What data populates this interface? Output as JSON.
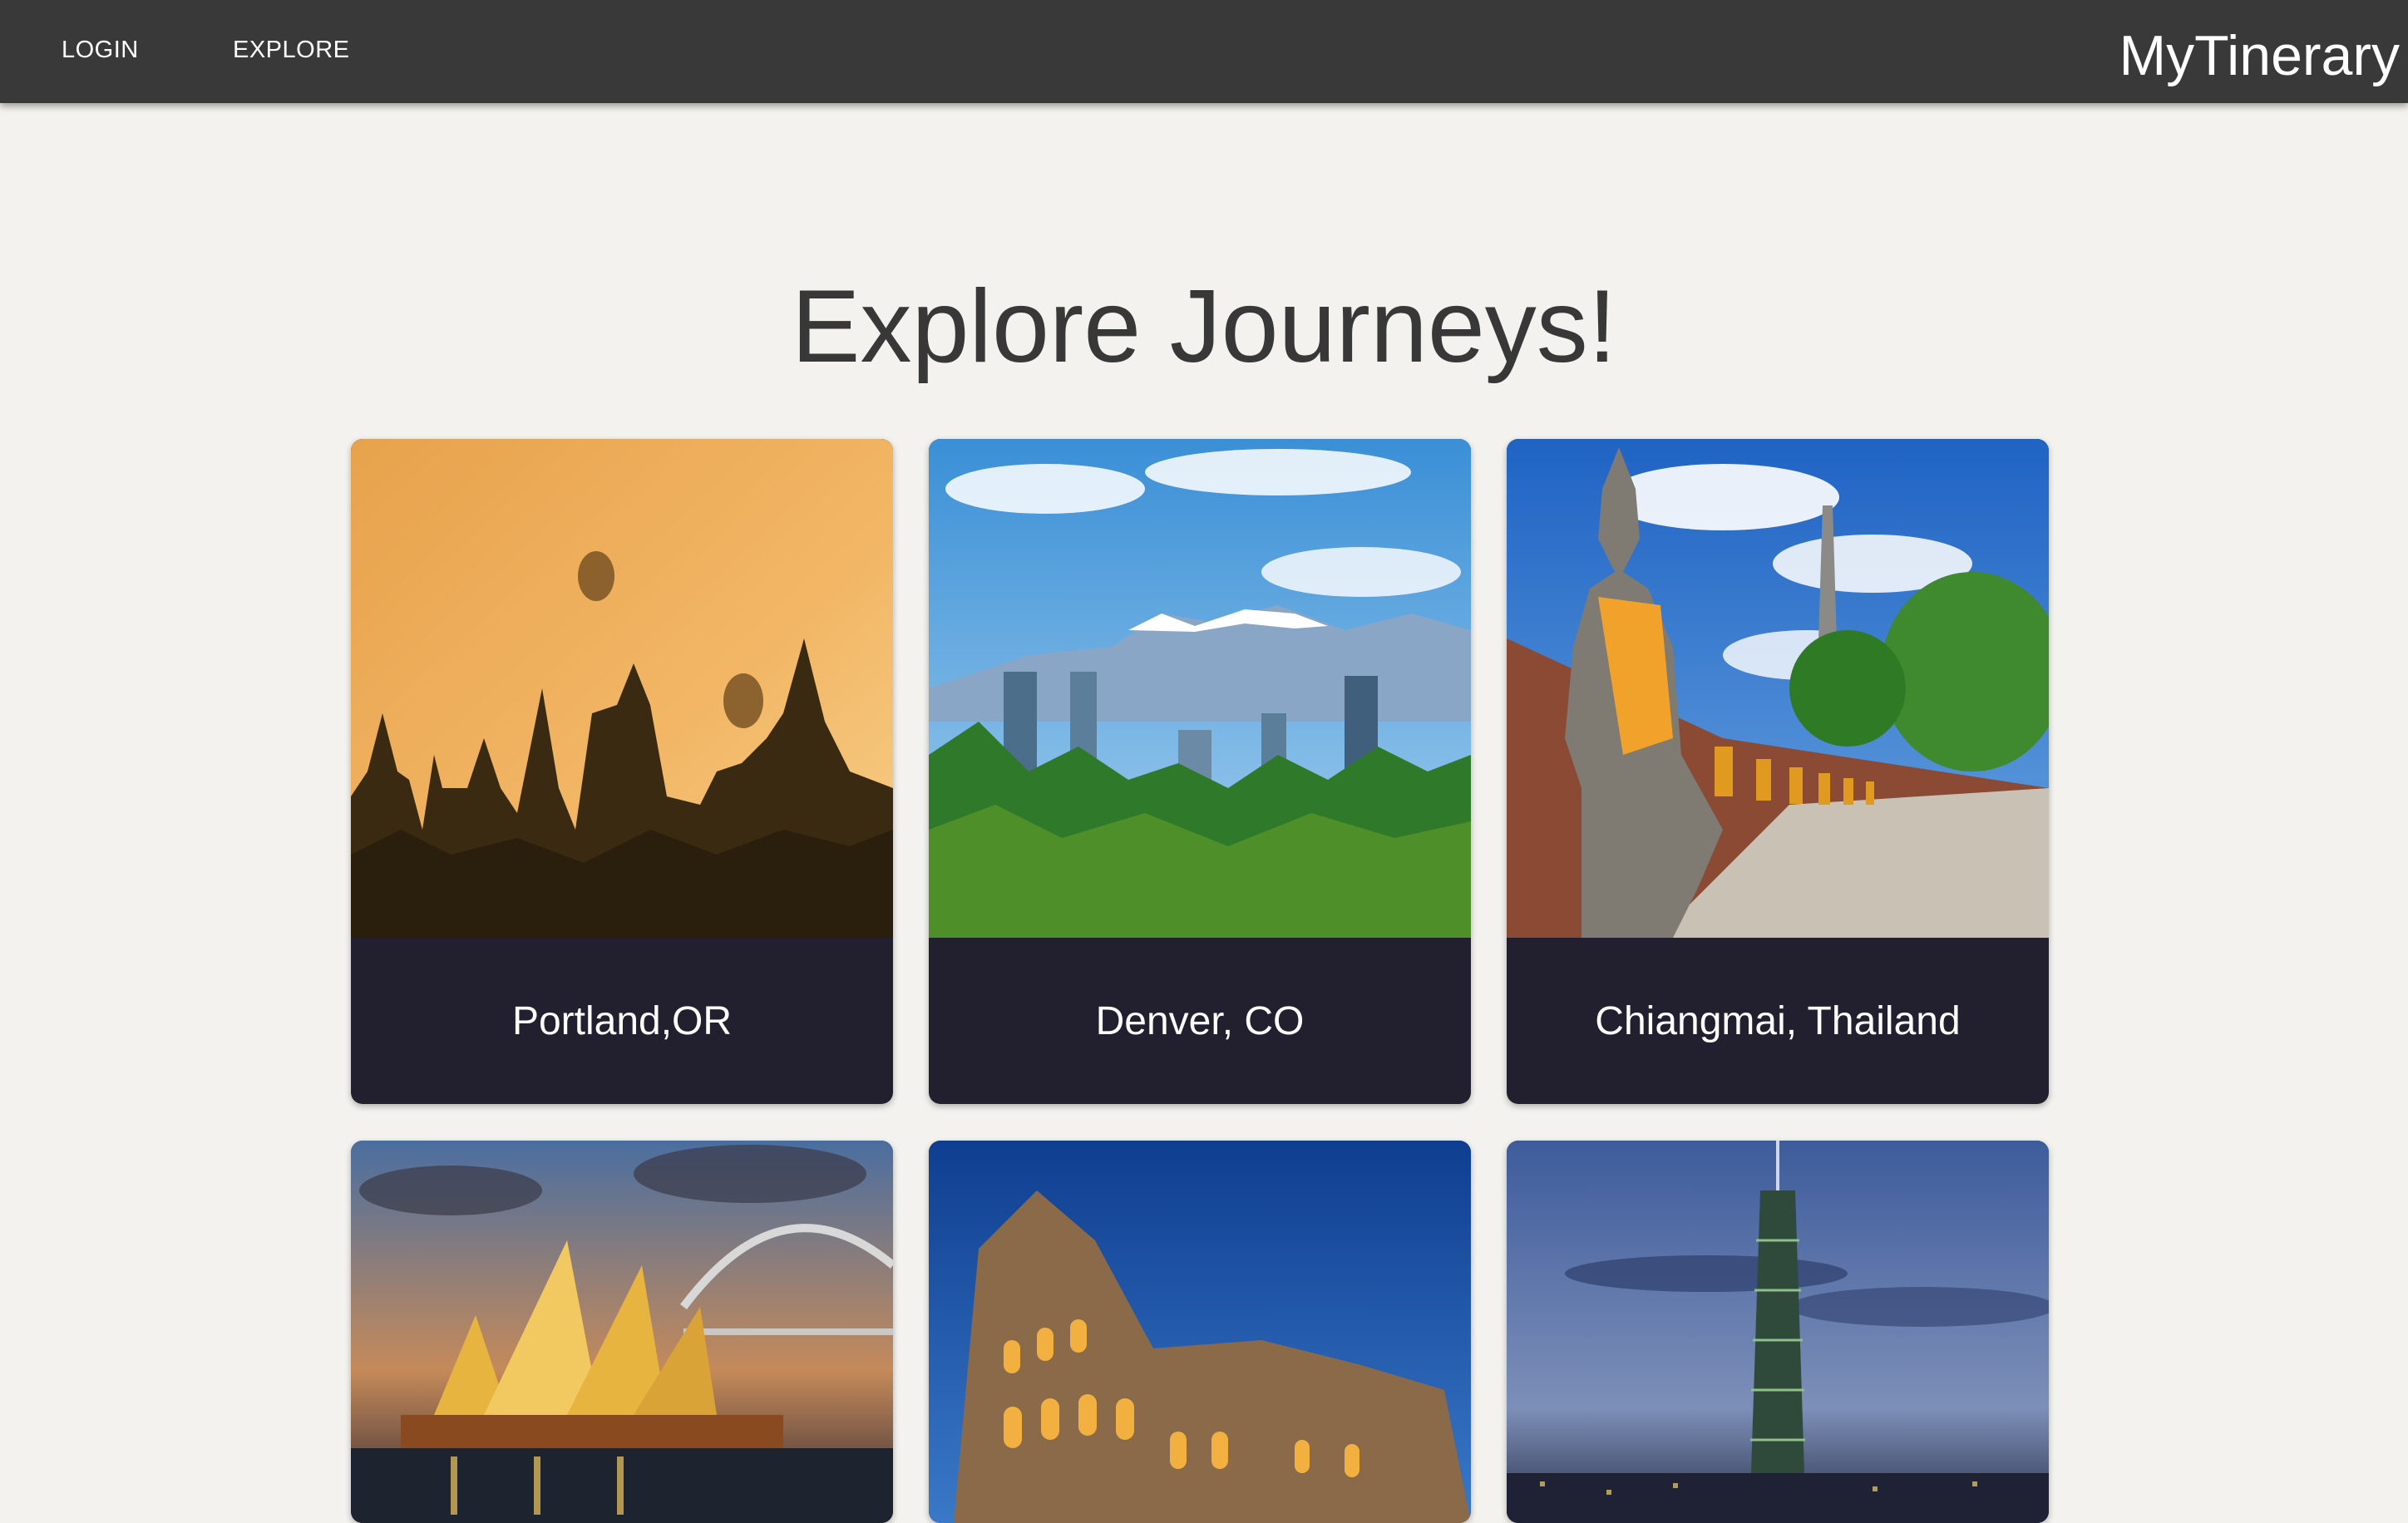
{
  "nav": {
    "login_label": "LOGIN",
    "explore_label": "EXPLORE",
    "brand": "MyTinerary"
  },
  "page": {
    "heading": "Explore Journeys!"
  },
  "cities": [
    {
      "name": "Portland,OR",
      "scene": "temples-at-sunrise-with-balloons"
    },
    {
      "name": "Denver, CO",
      "scene": "city-skyline-with-mountains"
    },
    {
      "name": "Chiangmai, Thailand",
      "scene": "buddha-statues-row"
    },
    {
      "scene": "opera-house-and-bridge-at-night"
    },
    {
      "scene": "colosseum-at-dusk"
    },
    {
      "scene": "skyscraper-at-dusk"
    }
  ],
  "colors": {
    "appbar": "#393939",
    "background": "#f3f2ee",
    "card_footer": "#22202e",
    "heading_text": "#383838"
  }
}
